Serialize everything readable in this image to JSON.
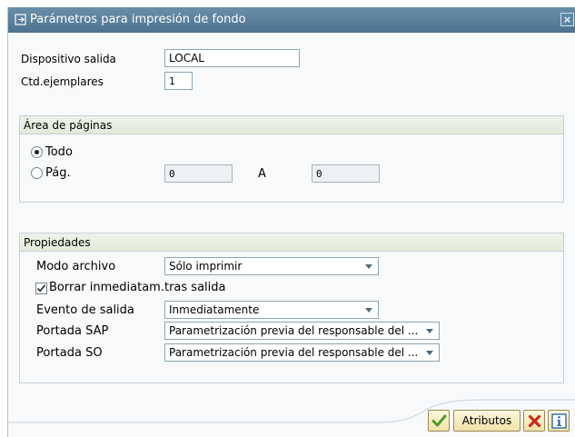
{
  "dialog": {
    "title": "Parámetros para impresión de fondo",
    "close_symbol": "×"
  },
  "fields": {
    "output_device_label": "Dispositivo salida",
    "output_device_value": "LOCAL",
    "copies_label": "Ctd.ejemplares",
    "copies_value": "1"
  },
  "page_range": {
    "heading": "Área de páginas",
    "all_label": "Todo",
    "all_selected": true,
    "page_label": "Pág.",
    "page_selected": false,
    "from_value": "0",
    "to_label": "A",
    "to_value": "0"
  },
  "properties": {
    "heading": "Propiedades",
    "archive_mode_label": "Modo archivo",
    "archive_mode_value": "Sólo imprimir",
    "delete_after_output_label": "Borrar inmediatam.tras salida",
    "delete_after_output_checked": true,
    "output_event_label": "Evento de salida",
    "output_event_value": "Inmediatamente",
    "sap_cover_label": "Portada SAP",
    "sap_cover_value": "Parametrización previa del responsable del ...",
    "so_cover_label": "Portada SO",
    "so_cover_value": "Parametrización previa del responsable del ..."
  },
  "buttons": {
    "confirm_icon": "checkmark-icon",
    "attributes_label": "Atributos",
    "cancel_icon": "cross-icon",
    "info_icon": "info-icon"
  },
  "colors": {
    "titlebar": "#5b7f9b",
    "group_header": "#e6eee0",
    "button_fill": "#f5e9b8",
    "check_green": "#4e9a2a",
    "cancel_red": "#cc2a18",
    "info_blue": "#2a6ab3"
  }
}
